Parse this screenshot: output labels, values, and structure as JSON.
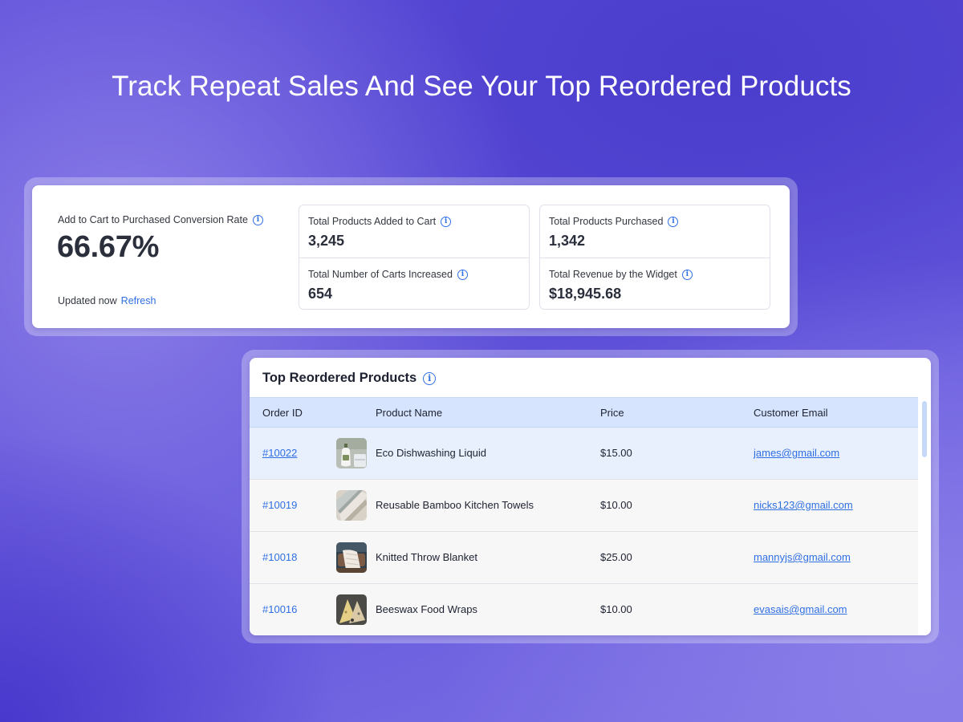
{
  "headline": "Track Repeat Sales And See Your Top Reordered Products",
  "stats": {
    "conversion": {
      "label": "Add to Cart to Purchased Conversion Rate",
      "value": "66.67%",
      "updated": "Updated now",
      "refresh": "Refresh"
    },
    "added_to_cart": {
      "label": "Total Products Added to Cart",
      "value": "3,245"
    },
    "carts_increased": {
      "label": "Total Number of Carts Increased",
      "value": "654"
    },
    "purchased": {
      "label": "Total Products Purchased",
      "value": "1,342"
    },
    "revenue": {
      "label": "Total Revenue by the Widget",
      "value": "$18,945.68"
    }
  },
  "table": {
    "title": "Top Reordered Products",
    "columns": [
      "Order ID",
      "Product Name",
      "Price",
      "Customer Email"
    ],
    "rows": [
      {
        "order_id": "#10022",
        "product": "Eco Dishwashing Liquid",
        "price": "$15.00",
        "email": "james@gmail.com",
        "thumb": "dish-soap-thumb"
      },
      {
        "order_id": "#10019",
        "product": "Reusable Bamboo Kitchen Towels",
        "price": "$10.00",
        "email": "nicks123@gmail.com",
        "thumb": "towels-thumb"
      },
      {
        "order_id": "#10018",
        "product": "Knitted Throw Blanket",
        "price": "$25.00",
        "email": "mannyjs@gmail.com",
        "thumb": "blanket-thumb"
      },
      {
        "order_id": "#10016",
        "product": "Beeswax Food Wraps",
        "price": "$10.00",
        "email": "evasais@gmail.com",
        "thumb": "wraps-thumb"
      }
    ]
  },
  "colors": {
    "accent": "#2f6fe4",
    "header_bg": "#d6e4fd",
    "highlight_row": "#e8f0fe"
  },
  "icons": {
    "info": "info-icon"
  }
}
